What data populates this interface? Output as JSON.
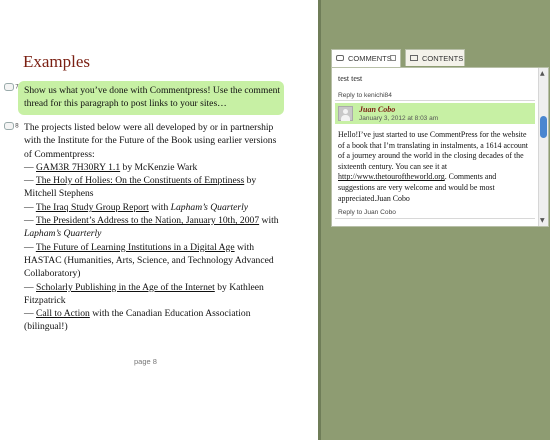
{
  "page": {
    "heading": "Examples",
    "paragraphs": [
      {
        "marker": "7",
        "text": "Show us what you’ve done with Commentpress! Use the comment thread for this paragraph to post links to your sites…"
      },
      {
        "marker": "8",
        "intro": "The projects listed below were all developed by or in partnership with the Institute for the Future of the Book using earlier versions of Commentpress:",
        "items": [
          {
            "dash": "— ",
            "link": "GAM3R 7H30RY 1.1",
            "rest": " by McKenzie Wark"
          },
          {
            "dash": "— ",
            "link": "The Holy of Holies: On the Constituents of Emptiness",
            "rest": " by Mitchell Stephens"
          },
          {
            "dash": "— ",
            "link": "The Iraq Study Group Report",
            "rest": " with ",
            "em": "Lapham’s Quarterly"
          },
          {
            "dash": "— ",
            "link": "The President’s Address to the Nation, January 10th, 2007",
            "rest": " with ",
            "em": "Lapham’s Quarterly"
          },
          {
            "dash": "— ",
            "link": "The Future of Learning Institutions in a Digital Age",
            "rest": " with HASTAC (Humanities, Arts, Science, and Technology Advanced Collaboratory)"
          },
          {
            "dash": "— ",
            "link": "Scholarly Publishing in the Age of the Internet",
            "rest": " by Kathleen Fitzpatrick"
          },
          {
            "dash": "— ",
            "link": "Call to Action",
            "rest": " with the Canadian Education Association (bilingual!)"
          }
        ]
      }
    ],
    "page_number": "page 8"
  },
  "sidebar": {
    "tabs": [
      {
        "label": "COMMENTS",
        "icon": "comment-bubble-icon",
        "active": true
      },
      {
        "label": "CONTENTS",
        "icon": "book-icon",
        "active": false
      }
    ],
    "comments": {
      "first_text": "test test",
      "first_reply": "Reply to kenichi84",
      "author": "Juan Cobo",
      "date": "January 3, 2012 at 8:03 am",
      "body_before": "Hello!I’ve just started to use CommentPress for the website of a book that I’m translating in instalments, a 1614 account of a journey around the world in the closing decades of the sixteenth century. You can see it at ",
      "body_link": "http://www.thetouroftheworld.org",
      "body_after": ". Comments and suggestions are very welcome and would be most appreciated.Juan Cobo",
      "second_reply": "Reply to Juan Cobo"
    }
  },
  "colors": {
    "heading": "#7a1f12",
    "highlight": "#c7f0a4",
    "sidebar_bg": "#8e9c72",
    "scroll_thumb": "#4a86d0"
  }
}
